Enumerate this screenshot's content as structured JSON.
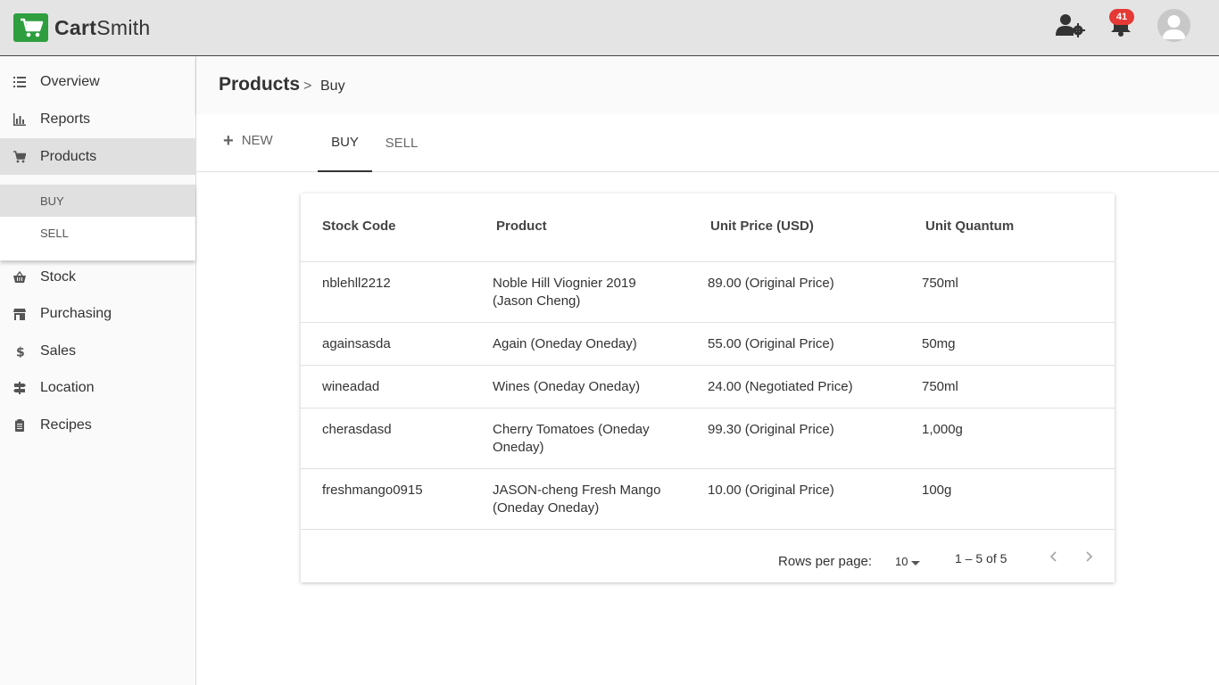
{
  "app": {
    "logo_part1": "Cart",
    "logo_part2": "Smith",
    "notification_count": "41"
  },
  "sidebar": {
    "items": [
      {
        "label": "Overview",
        "icon": "list-icon"
      },
      {
        "label": "Reports",
        "icon": "bar-chart-icon"
      },
      {
        "label": "Products",
        "icon": "cart-icon"
      },
      {
        "label": "Stock",
        "icon": "basket-icon"
      },
      {
        "label": "Purchasing",
        "icon": "store-icon"
      },
      {
        "label": "Sales",
        "icon": "dollar-icon"
      },
      {
        "label": "Location",
        "icon": "signpost-icon"
      },
      {
        "label": "Recipes",
        "icon": "clipboard-icon"
      }
    ],
    "submenu": [
      {
        "label": "BUY"
      },
      {
        "label": "SELL"
      }
    ]
  },
  "header": {
    "title": "Products",
    "separator": ">",
    "sub": "Buy"
  },
  "toolbar": {
    "new_label": "NEW",
    "tabs": [
      {
        "label": "BUY"
      },
      {
        "label": "SELL"
      }
    ]
  },
  "table": {
    "columns": [
      "Stock Code",
      "Product",
      "Unit Price (USD)",
      "Unit Quantum"
    ],
    "rows": [
      [
        "nblehll2212",
        "Noble Hill Viognier 2019 (Jason Cheng)",
        "89.00 (Original Price)",
        "750ml"
      ],
      [
        "againsasda",
        "Again (Oneday Oneday)",
        "55.00 (Original Price)",
        "50mg"
      ],
      [
        "wineadad",
        "Wines (Oneday Oneday)",
        "24.00 (Negotiated Price)",
        "750ml"
      ],
      [
        "cherasdasd",
        "Cherry Tomatoes (Oneday Oneday)",
        "99.30 (Original Price)",
        "1,000g"
      ],
      [
        "freshmango0915",
        "JASON-cheng Fresh Mango (Oneday Oneday)",
        "10.00 (Original Price)",
        "100g"
      ]
    ],
    "pagination": {
      "rows_per_page_label": "Rows per page:",
      "rows_per_page": "10",
      "range": "1 – 5 of 5"
    }
  },
  "colors": {
    "brand": "#2e9e3f",
    "badge": "#e53935",
    "topbar": "#e4e4e4"
  }
}
